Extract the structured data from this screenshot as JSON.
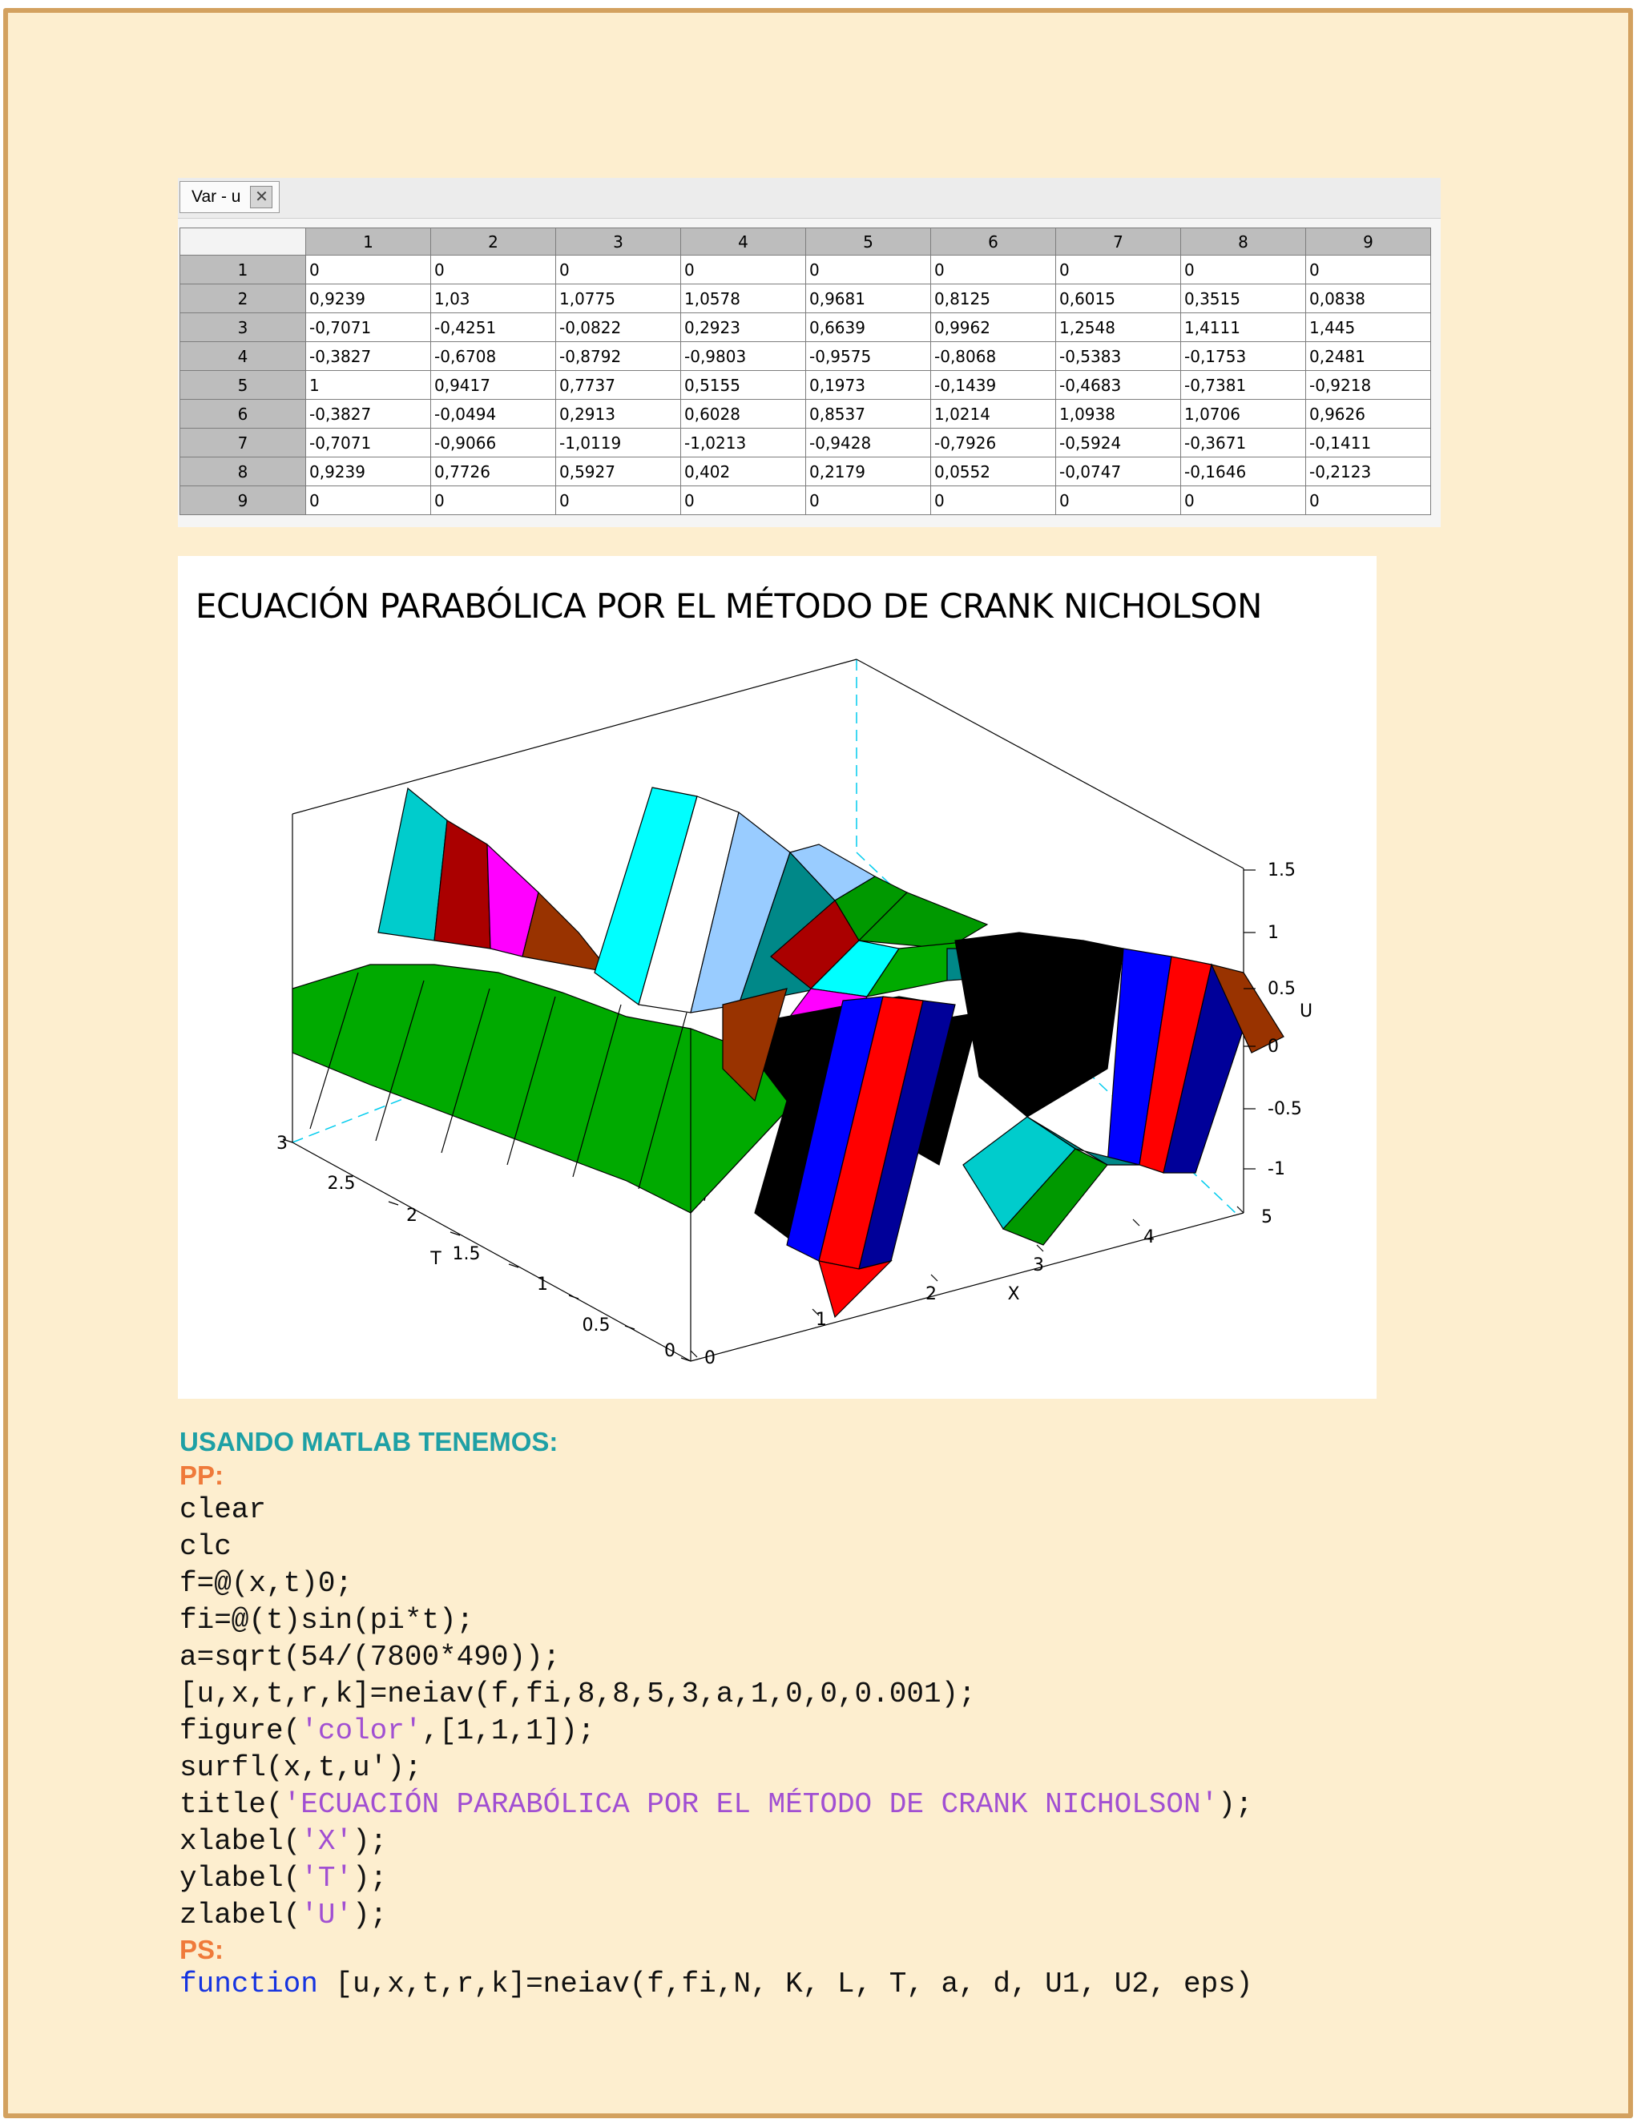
{
  "variable_editor": {
    "tab_label": "Var - u",
    "close_icon": "close-icon",
    "column_headers": [
      "1",
      "2",
      "3",
      "4",
      "5",
      "6",
      "7",
      "8",
      "9"
    ],
    "row_headers": [
      "1",
      "2",
      "3",
      "4",
      "5",
      "6",
      "7",
      "8",
      "9"
    ],
    "rows": [
      [
        "0",
        "0",
        "0",
        "0",
        "0",
        "0",
        "0",
        "0",
        "0"
      ],
      [
        "0,9239",
        "1,03",
        "1,0775",
        "1,0578",
        "0,9681",
        "0,8125",
        "0,6015",
        "0,3515",
        "0,0838"
      ],
      [
        "-0,7071",
        "-0,4251",
        "-0,0822",
        "0,2923",
        "0,6639",
        "0,9962",
        "1,2548",
        "1,4111",
        "1,445"
      ],
      [
        "-0,3827",
        "-0,6708",
        "-0,8792",
        "-0,9803",
        "-0,9575",
        "-0,8068",
        "-0,5383",
        "-0,1753",
        "0,2481"
      ],
      [
        "1",
        "0,9417",
        "0,7737",
        "0,5155",
        "0,1973",
        "-0,1439",
        "-0,4683",
        "-0,7381",
        "-0,9218"
      ],
      [
        "-0,3827",
        "-0,0494",
        "0,2913",
        "0,6028",
        "0,8537",
        "1,0214",
        "1,0938",
        "1,0706",
        "0,9626"
      ],
      [
        "-0,7071",
        "-0,9066",
        "-1,0119",
        "-1,0213",
        "-0,9428",
        "-0,7926",
        "-0,5924",
        "-0,3671",
        "-0,1411"
      ],
      [
        "0,9239",
        "0,7726",
        "0,5927",
        "0,402",
        "0,2179",
        "0,0552",
        "-0,0747",
        "-0,1646",
        "-0,2123"
      ],
      [
        "0",
        "0",
        "0",
        "0",
        "0",
        "0",
        "0",
        "0",
        "0"
      ]
    ]
  },
  "plot": {
    "title": "ECUACIÓN PARABÓLICA POR EL MÉTODO DE CRANK NICHOLSON",
    "z_label": "U",
    "x_label": "X",
    "t_label": "T",
    "z_ticks": [
      "1.5",
      "1",
      "0.5",
      "0",
      "-0.5",
      "-1"
    ],
    "x_ticks": [
      "0",
      "1",
      "2",
      "3",
      "4",
      "5"
    ],
    "t_ticks": [
      "0",
      "0.5",
      "1",
      "1.5",
      "2",
      "2.5",
      "3"
    ],
    "surface_colors": [
      "#00aa00",
      "#000000",
      "#0000ff",
      "#ff0000",
      "#000099",
      "#00cccc",
      "#ff00ff",
      "#993300",
      "#00ffff",
      "#ffffff",
      "#99ccff",
      "#008888",
      "#aa0000",
      "#009900"
    ]
  },
  "code": {
    "heading": "USANDO MATLAB TENEMOS:",
    "pp_label": "PP:",
    "pp_lines": [
      {
        "plain": "clear"
      },
      {
        "plain": "clc"
      },
      {
        "plain": "f=@(x,t)0;"
      },
      {
        "plain": "fi=@(t)sin(pi*t);"
      },
      {
        "plain": "a=sqrt(54/(7800*490));"
      },
      {
        "plain": "[u,x,t,r,k]=neiav(f,fi,8,8,5,3,a,1,0,0,0.001);"
      },
      {
        "pre": "figure(",
        "str": "'color'",
        "post": ",[1,1,1]);"
      },
      {
        "plain": "surfl(x,t,u');"
      },
      {
        "pre": "title(",
        "str": "'ECUACIÓN PARABÓLICA POR EL MÉTODO DE CRANK NICHOLSON'",
        "post": ");"
      },
      {
        "pre": "xlabel(",
        "str": "'X'",
        "post": ");"
      },
      {
        "pre": "ylabel(",
        "str": "'T'",
        "post": ");"
      },
      {
        "pre": "zlabel(",
        "str": "'U'",
        "post": ");"
      }
    ],
    "ps_label": "PS:",
    "ps_keyword": "function",
    "ps_signature": " [u,x,t,r,k]=neiav(f,fi,N, K, L, T, a, d, U1, U2, eps)"
  }
}
